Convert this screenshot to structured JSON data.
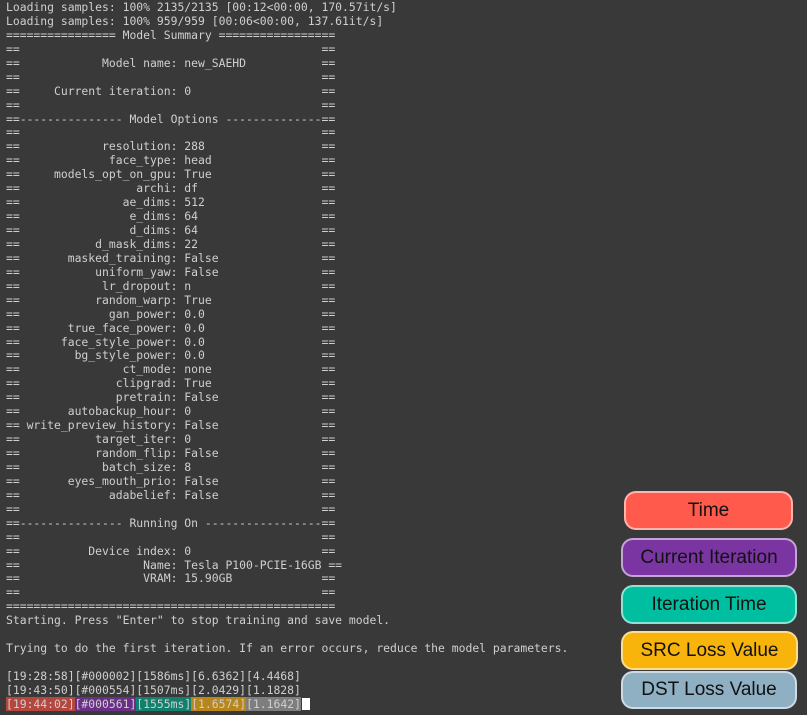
{
  "terminal": {
    "lines": [
      "Loading samples: 100% 2135/2135 [00:12<00:00, 170.57it/s]",
      "Loading samples: 100% 959/959 [00:06<00:00, 137.61it/s]",
      "================ Model Summary =================",
      "==                                            ==",
      "==            Model name: new_SAEHD           ==",
      "==                                            ==",
      "==     Current iteration: 0                   ==",
      "==                                            ==",
      "==--------------- Model Options --------------==",
      "==                                            ==",
      "==            resolution: 288                 ==",
      "==             face_type: head                ==",
      "==     models_opt_on_gpu: True                ==",
      "==                 archi: df                  ==",
      "==               ae_dims: 512                 ==",
      "==                e_dims: 64                  ==",
      "==                d_dims: 64                  ==",
      "==           d_mask_dims: 22                  ==",
      "==       masked_training: False               ==",
      "==           uniform_yaw: False               ==",
      "==            lr_dropout: n                   ==",
      "==           random_warp: True                ==",
      "==             gan_power: 0.0                 ==",
      "==       true_face_power: 0.0                 ==",
      "==      face_style_power: 0.0                 ==",
      "==        bg_style_power: 0.0                 ==",
      "==               ct_mode: none                ==",
      "==              clipgrad: True                ==",
      "==              pretrain: False               ==",
      "==       autobackup_hour: 0                   ==",
      "== write_preview_history: False               ==",
      "==           target_iter: 0                   ==",
      "==           random_flip: False               ==",
      "==            batch_size: 8                   ==",
      "==       eyes_mouth_prio: False               ==",
      "==             adabelief: False               ==",
      "==                                            ==",
      "==--------------- Running On -----------------==",
      "==                                            ==",
      "==          Device index: 0                   ==",
      "==                  Name: Tesla P100-PCIE-16GB ==",
      "==                  VRAM: 15.90GB             ==",
      "==                                            ==",
      "================================================",
      "Starting. Press \"Enter\" to stop training and save model.",
      "",
      "Trying to do the first iteration. If an error occurs, reduce the model parameters.",
      "",
      "[19:28:58][#000002][1586ms][6.6362][4.4468]",
      "[19:43:50][#000554][1507ms][2.0429][1.1828]"
    ],
    "last_line": {
      "time": "[19:44:02]",
      "iteration": "[#000561]",
      "iteration_time": "[1555ms]",
      "src_loss": "[1.6574]",
      "dst_loss": "[1.1642]"
    }
  },
  "legend": [
    {
      "label": "Time",
      "color": "#ff5a4c"
    },
    {
      "label": "Current Iteration",
      "color": "#7a35a2"
    },
    {
      "label": "Iteration Time",
      "color": "#00bfa0"
    },
    {
      "label": "SRC Loss Value",
      "color": "#f9b40b"
    },
    {
      "label": "DST Loss Value",
      "color": "#8fb0c3"
    }
  ],
  "colors": {
    "background": "#393939",
    "text": "#cfcfcf",
    "hl_time": "#b5473f",
    "hl_iteration": "#6a3088",
    "hl_iteration_time": "#11806d",
    "hl_src_loss": "#b8861b",
    "hl_dst_loss": "#7e7e7e"
  }
}
